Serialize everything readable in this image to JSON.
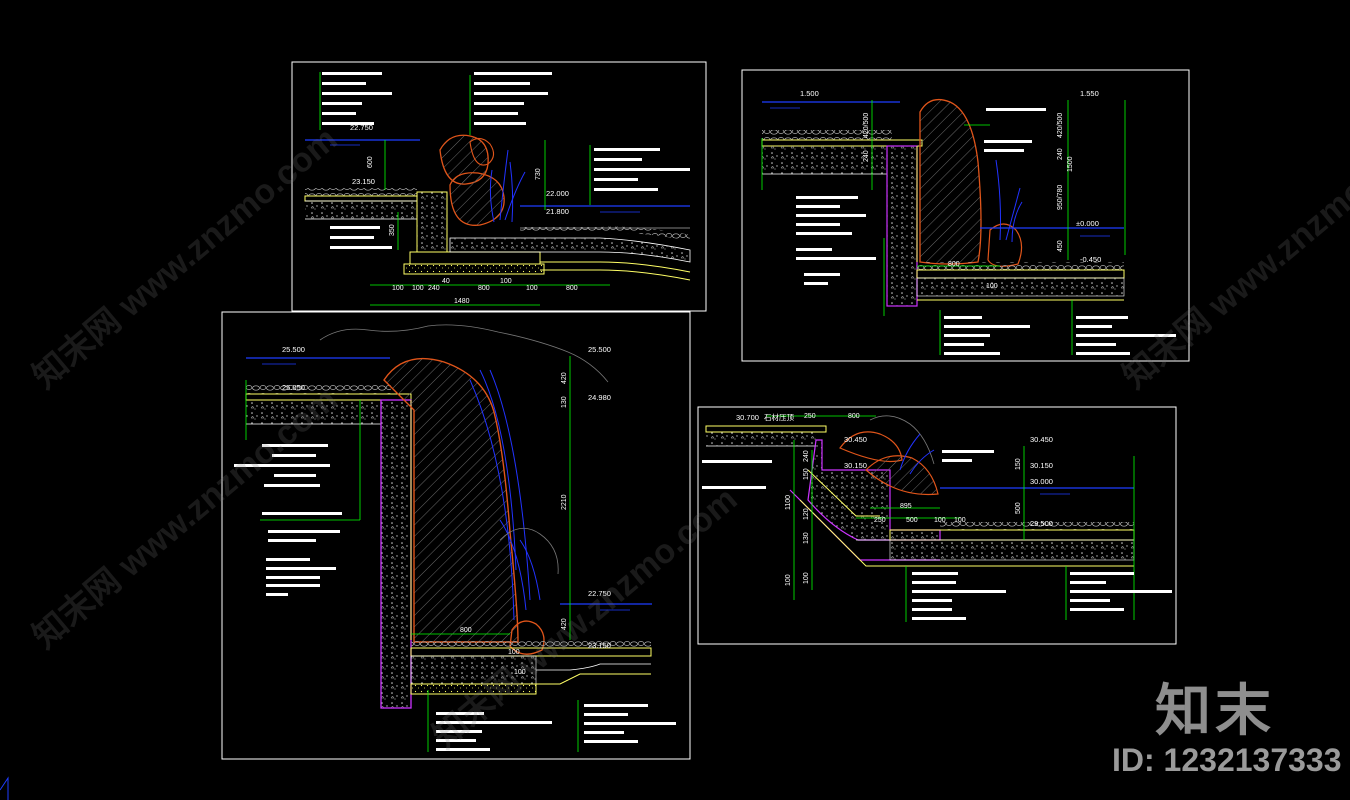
{
  "colors": {
    "background": "#000000",
    "frame": "#ffffff",
    "text": "#ffffff",
    "dim": "#00ff00",
    "water": "#1e3cff",
    "rock": "#e0551a",
    "soil": "#d9d9d9",
    "gravel": "#ffff66",
    "wall": "#cc33ff",
    "plant": "#2233ff",
    "cyan": "#00d0ff"
  },
  "watermark": {
    "logo_text": "知末",
    "id_text": "ID: 1232137333",
    "diagonal_text": "知末网 www.znzmo.com"
  },
  "panel1": {
    "elevations": [
      "22.750",
      "23.150",
      "22.000",
      "21.800"
    ],
    "dims_bottom": [
      "100",
      "100",
      "240",
      "40",
      "800",
      "100",
      "100",
      "800"
    ],
    "dim_total": "1480",
    "dims_vert": [
      "600",
      "730",
      "350"
    ]
  },
  "panel2": {
    "elevations": [
      "1.500",
      "1.550",
      "±0.000",
      "-0.450"
    ],
    "dims_vert": [
      "420/500",
      "240",
      "1500",
      "950/780",
      "450",
      "420/500",
      "240"
    ],
    "dims_horiz": [
      "800",
      "100"
    ]
  },
  "panel3": {
    "elevations": [
      "25.500",
      "25.050",
      "25.500",
      "24.980",
      "22.750",
      "23.150"
    ],
    "dims_vert": [
      "420",
      "130",
      "2210",
      "420"
    ],
    "dims_horiz": [
      "800",
      "100",
      "100"
    ]
  },
  "panel4": {
    "elevations": [
      "30.700",
      "30.450",
      "30.150",
      "30.450",
      "30.150",
      "30.000",
      "29.500"
    ],
    "dims_horiz": [
      "250",
      "800",
      "895",
      "250",
      "500",
      "100",
      "100"
    ],
    "dims_vert": [
      "240",
      "150",
      "120",
      "130",
      "100",
      "150",
      "500",
      "1100",
      "100"
    ],
    "top_note": "石材压顶"
  }
}
